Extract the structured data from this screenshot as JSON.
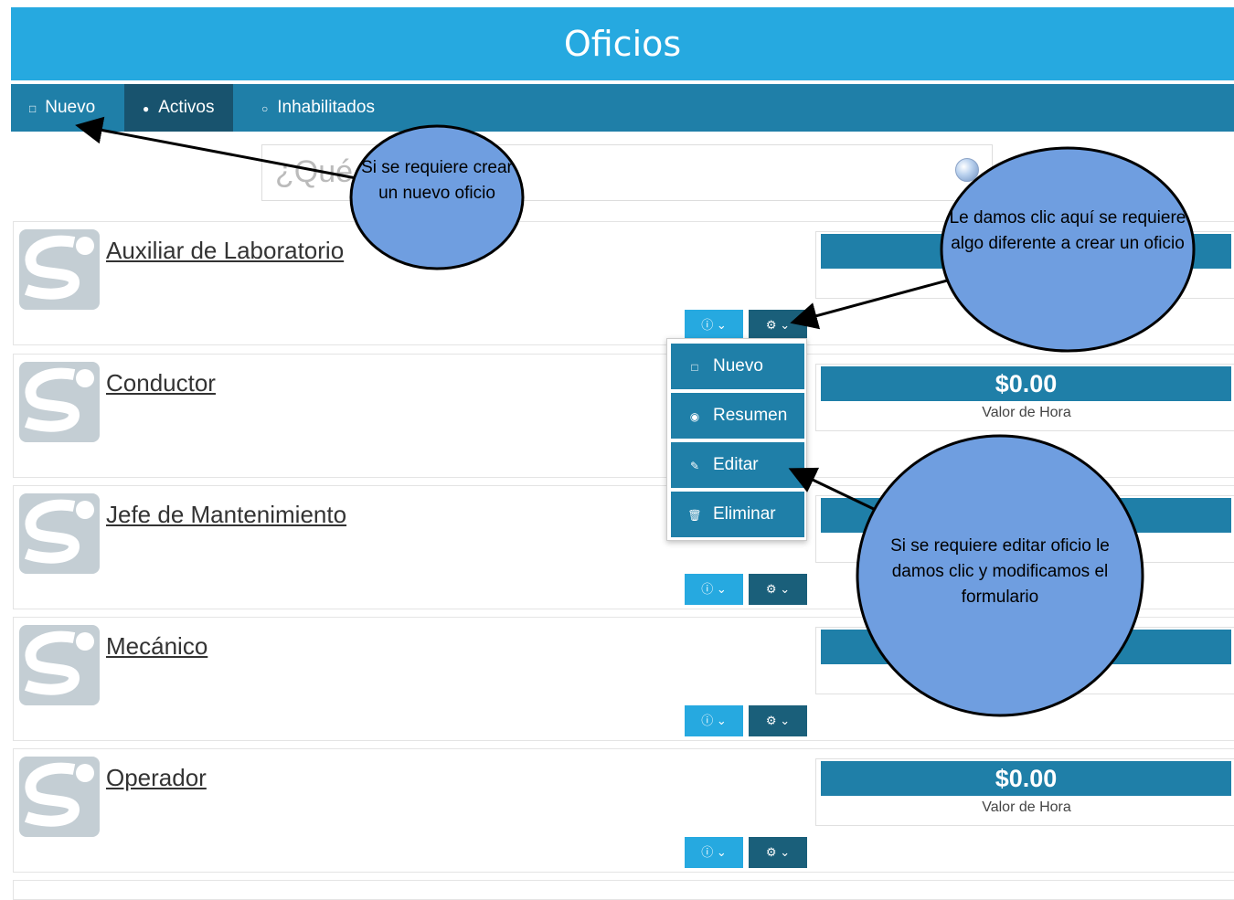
{
  "header": {
    "title": "Oficios"
  },
  "toolbar": {
    "new_label": "Nuevo",
    "active_label": "Activos",
    "disabled_label": "Inhabilitados"
  },
  "search": {
    "placeholder": "¿Qué"
  },
  "cards": [
    {
      "name": "Auxiliar de Laboratorio",
      "price": "",
      "price_label": ""
    },
    {
      "name": "Conductor",
      "price": "$0.00",
      "price_label": "Valor de Hora"
    },
    {
      "name": "Jefe de Mantenimiento",
      "price": "",
      "price_label": ""
    },
    {
      "name": "Mecánico",
      "price": "",
      "price_label": ""
    },
    {
      "name": "Operador",
      "price": "$0.00",
      "price_label": "Valor de Hora"
    }
  ],
  "dropdown": {
    "items": [
      {
        "label": "Nuevo",
        "icon": "new-doc-icon"
      },
      {
        "label": "Resumen",
        "icon": "summary-icon"
      },
      {
        "label": "Editar",
        "icon": "pencil-icon"
      },
      {
        "label": "Eliminar",
        "icon": "trash-icon"
      }
    ]
  },
  "callouts": {
    "new": "Si se requiere crear un nuevo oficio",
    "gear": "Le damos clic aquí se requiere algo diferente a crear un oficio",
    "edit": "Si se requiere editar oficio le damos clic y modificamos el formulario"
  },
  "colors": {
    "header": "#26a9e0",
    "toolbar": "#1f7fa8",
    "toolbar_active": "#18536e",
    "info_button": "#26a9e0",
    "gear_button": "#1a5f7a",
    "price_bar": "#1f7fa8",
    "callout_fill": "#6f9ee0"
  }
}
